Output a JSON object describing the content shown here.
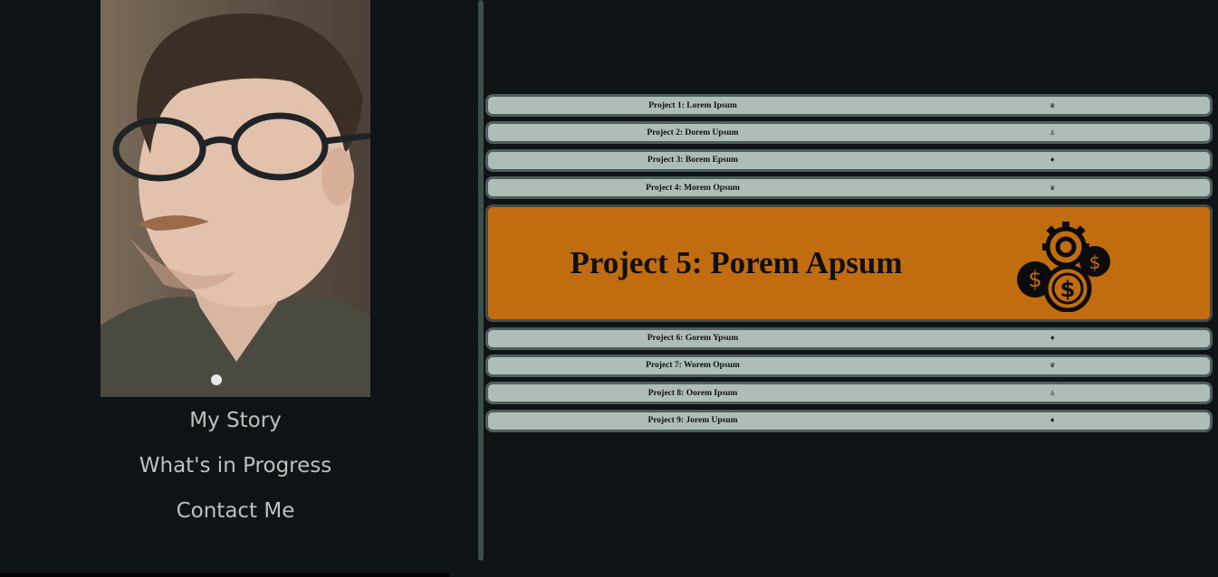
{
  "profile": {
    "photo_alt": "portrait"
  },
  "nav": {
    "items": [
      {
        "label": "My Story"
      },
      {
        "label": "What's in Progress"
      },
      {
        "label": "Contact Me"
      }
    ]
  },
  "projects": [
    {
      "title": "Project 1: Lorem Ipsum",
      "icon": "crown-icon",
      "glyph": "♛"
    },
    {
      "title": "Project 2: Dorem Upsum",
      "icon": "cat-icon",
      "glyph": "♙"
    },
    {
      "title": "Project 3: Borem Epsum",
      "icon": "tie-icon",
      "glyph": "♦"
    },
    {
      "title": "Project 4: Morem Opsum",
      "icon": "crown-icon",
      "glyph": "♛"
    },
    {
      "title": "Project 5: Porem Apsum",
      "icon": "gear-dollar-coins-icon",
      "active": true
    },
    {
      "title": "Project 6: Gorem Ypsum",
      "icon": "tie-icon",
      "glyph": "♦"
    },
    {
      "title": "Project 7: Worem Opsum",
      "icon": "crown-icon",
      "glyph": "♛"
    },
    {
      "title": "Project 8: Oorem Ipsum",
      "icon": "cat-icon",
      "glyph": "♙"
    },
    {
      "title": "Project 9: Jorem Upsum",
      "icon": "tie-icon",
      "glyph": "♦"
    }
  ],
  "colors": {
    "background": "#0e1415",
    "divider": "#3b4e47",
    "project_bar": "#aebdb8",
    "project_active": "#c06c0f",
    "nav_text": "#b9c2bf"
  }
}
